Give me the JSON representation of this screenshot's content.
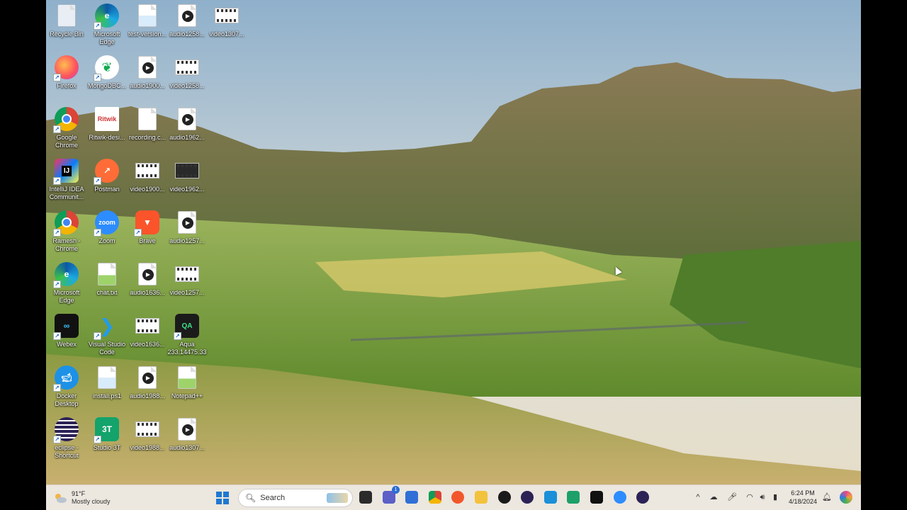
{
  "desktop": {
    "icons": [
      {
        "label": "Recycle Bin",
        "icon": "recycle-bin-icon",
        "kind": "recycle"
      },
      {
        "label": "Microsoft Edge",
        "icon": "edge-icon",
        "kind": "edge"
      },
      {
        "label": "test-version...",
        "icon": "document-icon",
        "kind": "doc"
      },
      {
        "label": "audio1258...",
        "icon": "audio-file-icon",
        "kind": "audio"
      },
      {
        "label": "video1307...",
        "icon": "video-file-icon",
        "kind": "video"
      },
      {
        "label": "Firefox",
        "icon": "firefox-icon",
        "kind": "firefox"
      },
      {
        "label": "MongoDBC...",
        "icon": "mongodb-icon",
        "kind": "mongo"
      },
      {
        "label": "audio1900...",
        "icon": "audio-file-icon",
        "kind": "audio"
      },
      {
        "label": "video1258...",
        "icon": "video-file-icon",
        "kind": "video"
      },
      {
        "label": "Google Chrome",
        "icon": "chrome-icon",
        "kind": "chrome"
      },
      {
        "label": "Ritwik-desi...",
        "icon": "image-file-icon",
        "kind": "ritwik"
      },
      {
        "label": "recording.c...",
        "icon": "blank-file-icon",
        "kind": "blank"
      },
      {
        "label": "audio1962...",
        "icon": "audio-file-icon",
        "kind": "audio"
      },
      {
        "label": "IntelliJ IDEA Communit...",
        "icon": "intellij-icon",
        "kind": "intellij"
      },
      {
        "label": "Postman",
        "icon": "postman-icon",
        "kind": "postman"
      },
      {
        "label": "video1900...",
        "icon": "video-file-icon",
        "kind": "video"
      },
      {
        "label": "video1962...",
        "icon": "video-file-icon",
        "kind": "videodark"
      },
      {
        "label": "Ramesh - Chrome",
        "icon": "chrome-profile-icon",
        "kind": "chrome"
      },
      {
        "label": "Zoom",
        "icon": "zoom-icon",
        "kind": "zoom"
      },
      {
        "label": "Brave",
        "icon": "brave-icon",
        "kind": "brave"
      },
      {
        "label": "audio1257...",
        "icon": "audio-file-icon",
        "kind": "audio"
      },
      {
        "label": "Microsoft Edge",
        "icon": "edge-icon",
        "kind": "edge"
      },
      {
        "label": "chat.txt",
        "icon": "text-file-icon",
        "kind": "chat"
      },
      {
        "label": "audio1636...",
        "icon": "audio-file-icon",
        "kind": "audio"
      },
      {
        "label": "video1257...",
        "icon": "video-file-icon",
        "kind": "video"
      },
      {
        "label": "Webex",
        "icon": "webex-icon",
        "kind": "webex"
      },
      {
        "label": "Visual Studio Code",
        "icon": "vscode-icon",
        "kind": "vscode"
      },
      {
        "label": "video1636...",
        "icon": "video-file-icon",
        "kind": "video"
      },
      {
        "label": "Aqua 233.14475.33",
        "icon": "aqua-icon",
        "kind": "aqua"
      },
      {
        "label": "Docker Desktop",
        "icon": "docker-icon",
        "kind": "docker"
      },
      {
        "label": "install.ps1",
        "icon": "script-file-icon",
        "kind": "doc"
      },
      {
        "label": "audio1988...",
        "icon": "audio-file-icon",
        "kind": "audio"
      },
      {
        "label": "Notepad++",
        "icon": "notepadpp-icon",
        "kind": "chat"
      },
      {
        "label": "eclipse - Shortcut",
        "icon": "eclipse-icon",
        "kind": "eclipse"
      },
      {
        "label": "Studio 3T",
        "icon": "studio3t-icon",
        "kind": "studio3t"
      },
      {
        "label": "video1988...",
        "icon": "video-file-icon",
        "kind": "video"
      },
      {
        "label": "audio1307...",
        "icon": "audio-file-icon",
        "kind": "audio"
      }
    ]
  },
  "taskbar": {
    "weather": {
      "temp": "91°F",
      "condition": "Mostly cloudy"
    },
    "search_placeholder": "Search",
    "apps": [
      {
        "name": "start-button",
        "icon": "windows-logo-icon",
        "color": "#1f78d1"
      },
      {
        "name": "taskbar-terminal",
        "icon": "terminal-icon",
        "color": "#2b2b2b"
      },
      {
        "name": "taskbar-chat",
        "icon": "chat-icon",
        "color": "#5b5fc7",
        "badge": "1"
      },
      {
        "name": "taskbar-store",
        "icon": "store-icon",
        "color": "#2f6fd6"
      },
      {
        "name": "taskbar-chrome",
        "icon": "chrome-icon",
        "color": "#e24a3b"
      },
      {
        "name": "taskbar-firefox",
        "icon": "firefox-icon",
        "color": "#f2572b"
      },
      {
        "name": "taskbar-explorer",
        "icon": "folder-icon",
        "color": "#f3c23c"
      },
      {
        "name": "taskbar-dell",
        "icon": "dell-icon",
        "color": "#1a1a1a"
      },
      {
        "name": "taskbar-eclipse",
        "icon": "eclipse-icon",
        "color": "#2c2255"
      },
      {
        "name": "taskbar-app-blue",
        "icon": "app-icon",
        "color": "#1b8fd8"
      },
      {
        "name": "taskbar-edge",
        "icon": "edge-icon",
        "color": "#1da06a"
      },
      {
        "name": "taskbar-webex",
        "icon": "webex-icon",
        "color": "#111"
      },
      {
        "name": "taskbar-zoom",
        "icon": "zoom-icon",
        "color": "#2d8cff"
      },
      {
        "name": "taskbar-eclipse-2",
        "icon": "eclipse-icon",
        "color": "#2c2255"
      }
    ],
    "tray": {
      "time": "6:24 PM",
      "date": "4/18/2024"
    }
  },
  "colors": {
    "taskbar_bg": "#ece7df",
    "accent": "#1f78d1"
  }
}
